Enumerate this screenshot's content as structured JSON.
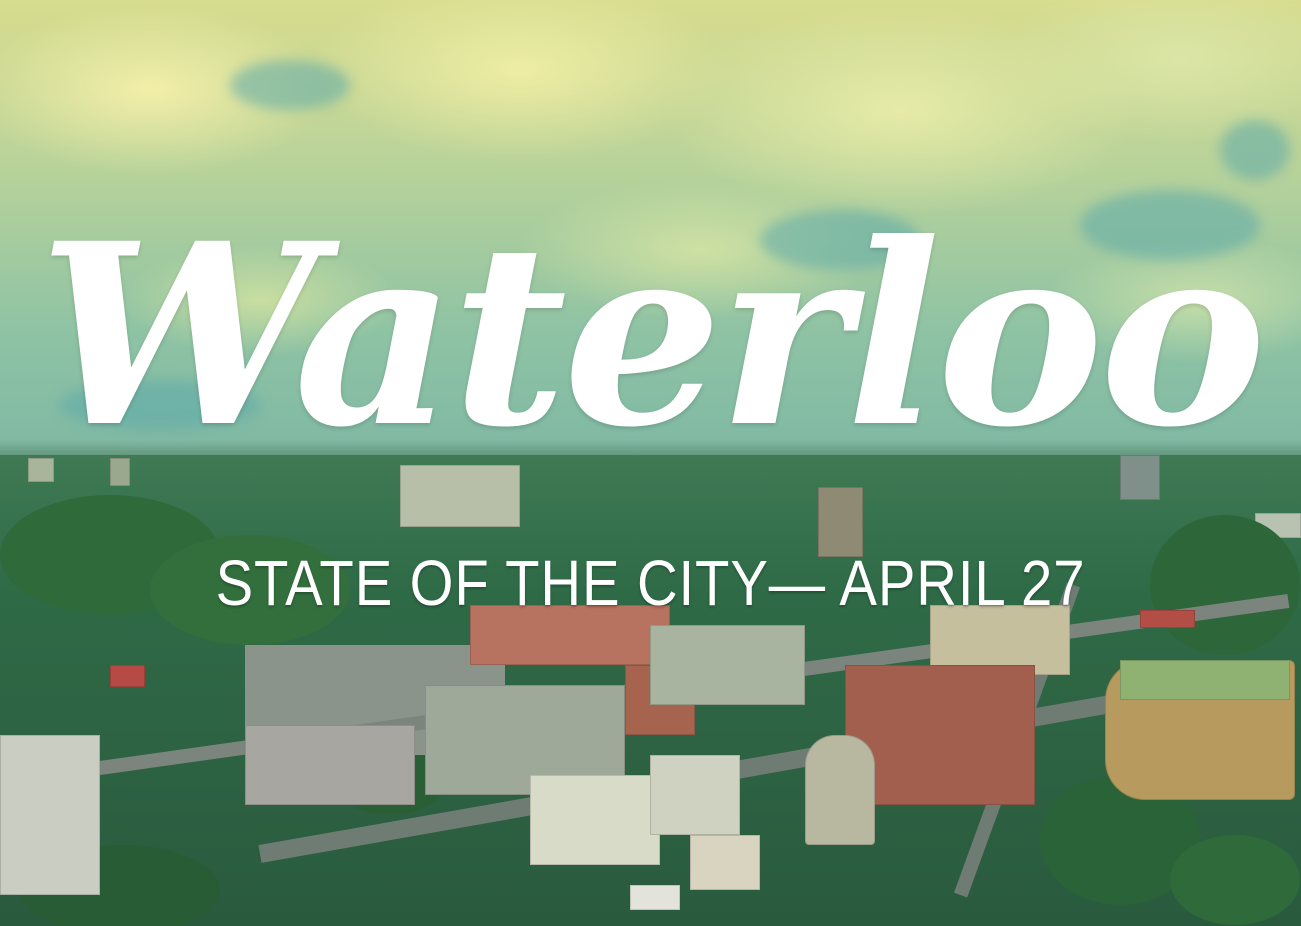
{
  "poster": {
    "title": "Waterloo",
    "subtitle": "STATE OF THE CITY— APRIL 27"
  },
  "colors": {
    "text": "#ffffff",
    "sky_top": "#d7dc8e",
    "sky_bottom": "#7db7a4",
    "greenery": "#2e6a46"
  }
}
